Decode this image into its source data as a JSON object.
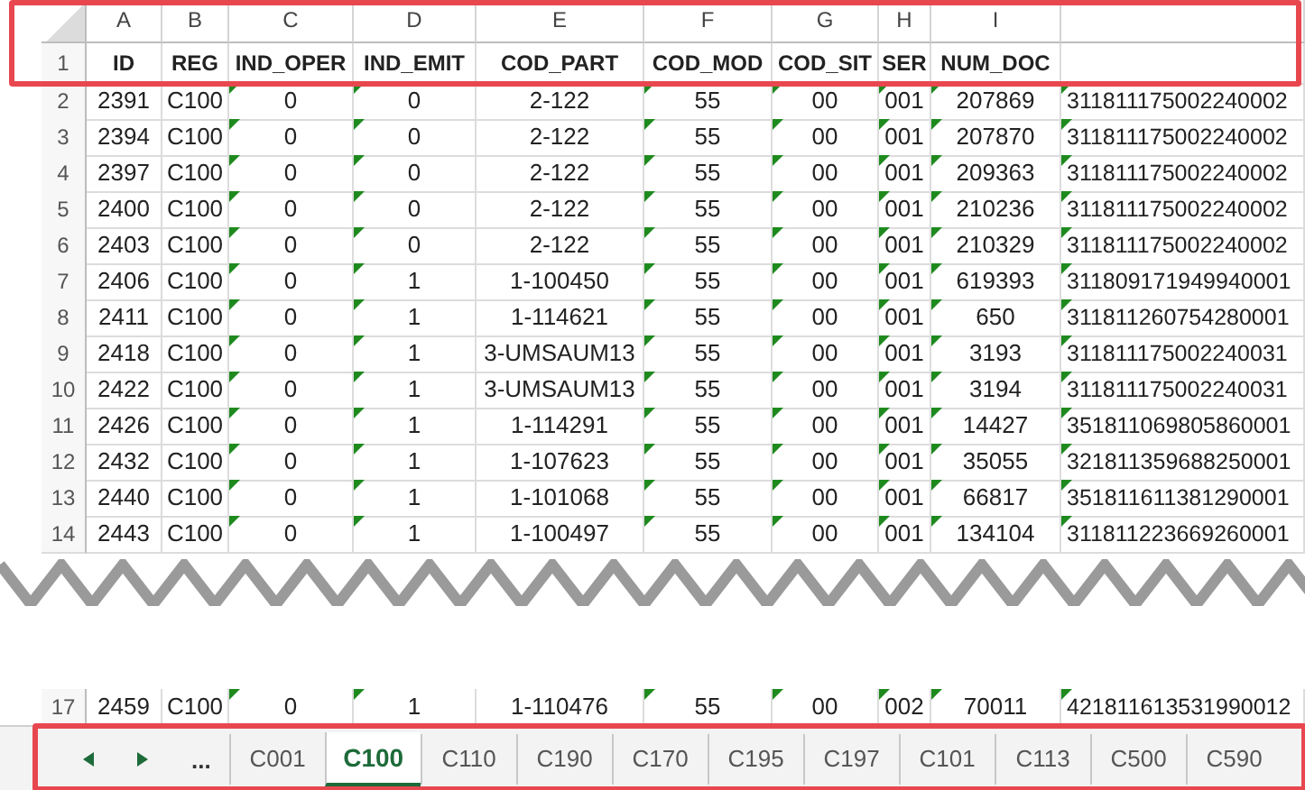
{
  "columns": [
    {
      "letter": "A",
      "header": "ID",
      "flag": false
    },
    {
      "letter": "B",
      "header": "REG",
      "flag": false
    },
    {
      "letter": "C",
      "header": "IND_OPER",
      "flag": true
    },
    {
      "letter": "D",
      "header": "IND_EMIT",
      "flag": true
    },
    {
      "letter": "E",
      "header": "COD_PART",
      "flag": false
    },
    {
      "letter": "F",
      "header": "COD_MOD",
      "flag": true
    },
    {
      "letter": "G",
      "header": "COD_SIT",
      "flag": true
    },
    {
      "letter": "H",
      "header": "SER",
      "flag": true
    },
    {
      "letter": "I",
      "header": "NUM_DOC",
      "flag": true
    },
    {
      "flag": true
    }
  ],
  "header_row_number": "1",
  "rows": [
    {
      "n": "2",
      "cells": [
        "2391",
        "C100",
        "0",
        "0",
        "2-122",
        "55",
        "00",
        "001",
        "207869",
        "311811175002240002"
      ]
    },
    {
      "n": "3",
      "cells": [
        "2394",
        "C100",
        "0",
        "0",
        "2-122",
        "55",
        "00",
        "001",
        "207870",
        "311811175002240002"
      ]
    },
    {
      "n": "4",
      "cells": [
        "2397",
        "C100",
        "0",
        "0",
        "2-122",
        "55",
        "00",
        "001",
        "209363",
        "311811175002240002"
      ]
    },
    {
      "n": "5",
      "cells": [
        "2400",
        "C100",
        "0",
        "0",
        "2-122",
        "55",
        "00",
        "001",
        "210236",
        "311811175002240002"
      ]
    },
    {
      "n": "6",
      "cells": [
        "2403",
        "C100",
        "0",
        "0",
        "2-122",
        "55",
        "00",
        "001",
        "210329",
        "311811175002240002"
      ]
    },
    {
      "n": "7",
      "cells": [
        "2406",
        "C100",
        "0",
        "1",
        "1-100450",
        "55",
        "00",
        "001",
        "619393",
        "311809171949940001"
      ]
    },
    {
      "n": "8",
      "cells": [
        "2411",
        "C100",
        "0",
        "1",
        "1-114621",
        "55",
        "00",
        "001",
        "650",
        "311811260754280001"
      ]
    },
    {
      "n": "9",
      "cells": [
        "2418",
        "C100",
        "0",
        "1",
        "3-UMSAUM13",
        "55",
        "00",
        "001",
        "3193",
        "311811175002240031"
      ]
    },
    {
      "n": "10",
      "cells": [
        "2422",
        "C100",
        "0",
        "1",
        "3-UMSAUM13",
        "55",
        "00",
        "001",
        "3194",
        "311811175002240031"
      ]
    },
    {
      "n": "11",
      "cells": [
        "2426",
        "C100",
        "0",
        "1",
        "1-114291",
        "55",
        "00",
        "001",
        "14427",
        "351811069805860001"
      ]
    },
    {
      "n": "12",
      "cells": [
        "2432",
        "C100",
        "0",
        "1",
        "1-107623",
        "55",
        "00",
        "001",
        "35055",
        "321811359688250001"
      ]
    },
    {
      "n": "13",
      "cells": [
        "2440",
        "C100",
        "0",
        "1",
        "1-101068",
        "55",
        "00",
        "001",
        "66817",
        "351811611381290001"
      ]
    },
    {
      "n": "14",
      "cells": [
        "2443",
        "C100",
        "0",
        "1",
        "1-100497",
        "55",
        "00",
        "001",
        "134104",
        "311811223669260001"
      ]
    }
  ],
  "rows_after_tear": [
    {
      "n": "17",
      "cells": [
        "2459",
        "C100",
        "0",
        "1",
        "1-110476",
        "55",
        "00",
        "002",
        "70011",
        "421811613531990012"
      ]
    }
  ],
  "sheet_nav": {
    "more": "..."
  },
  "sheet_tabs": [
    {
      "label": "C001",
      "selected": false
    },
    {
      "label": "C100",
      "selected": true
    },
    {
      "label": "C110",
      "selected": false
    },
    {
      "label": "C190",
      "selected": false
    },
    {
      "label": "C170",
      "selected": false
    },
    {
      "label": "C195",
      "selected": false
    },
    {
      "label": "C197",
      "selected": false
    },
    {
      "label": "C101",
      "selected": false
    },
    {
      "label": "C113",
      "selected": false
    },
    {
      "label": "C500",
      "selected": false
    },
    {
      "label": "C590",
      "selected": false
    }
  ]
}
